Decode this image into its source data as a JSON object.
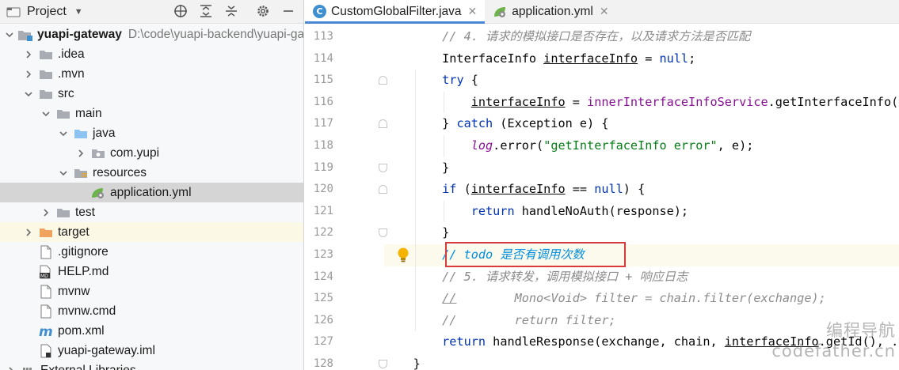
{
  "project_panel": {
    "title": "Project",
    "tree": [
      {
        "label": "yuapi-gateway",
        "path": "D:\\code\\yuapi-backend\\yuapi-gateway",
        "depth": 0,
        "expanded": true,
        "icon": "module-folder-icon",
        "bold": true
      },
      {
        "label": ".idea",
        "depth": 1,
        "expanded": false,
        "icon": "folder-icon"
      },
      {
        "label": ".mvn",
        "depth": 1,
        "expanded": false,
        "icon": "folder-icon"
      },
      {
        "label": "src",
        "depth": 1,
        "expanded": true,
        "icon": "folder-icon"
      },
      {
        "label": "main",
        "depth": 2,
        "expanded": true,
        "icon": "folder-icon"
      },
      {
        "label": "java",
        "depth": 3,
        "expanded": true,
        "icon": "source-folder-icon"
      },
      {
        "label": "com.yupi",
        "depth": 4,
        "expanded": false,
        "icon": "package-icon"
      },
      {
        "label": "resources",
        "depth": 3,
        "expanded": true,
        "icon": "resources-folder-icon"
      },
      {
        "label": "application.yml",
        "depth": 4,
        "icon": "yaml-spring-icon",
        "selected": true
      },
      {
        "label": "test",
        "depth": 2,
        "expanded": false,
        "icon": "folder-icon"
      },
      {
        "label": "target",
        "depth": 1,
        "expanded": false,
        "icon": "excluded-folder-icon"
      },
      {
        "label": ".gitignore",
        "depth": 1,
        "icon": "file-icon"
      },
      {
        "label": "HELP.md",
        "depth": 1,
        "icon": "markdown-icon"
      },
      {
        "label": "mvnw",
        "depth": 1,
        "icon": "file-icon"
      },
      {
        "label": "mvnw.cmd",
        "depth": 1,
        "icon": "file-icon"
      },
      {
        "label": "pom.xml",
        "depth": 1,
        "icon": "maven-icon"
      },
      {
        "label": "yuapi-gateway.iml",
        "depth": 1,
        "icon": "iml-icon"
      },
      {
        "label": "External Libraries",
        "depth": 0,
        "expanded": false,
        "icon": "library-icon"
      }
    ]
  },
  "tabs": [
    {
      "label": "CustomGlobalFilter.java",
      "icon": "java-class-icon",
      "active": true
    },
    {
      "label": "application.yml",
      "icon": "yaml-spring-icon",
      "active": false
    }
  ],
  "editor": {
    "line_numbers": [
      "113",
      "114",
      "115",
      "116",
      "117",
      "118",
      "119",
      "120",
      "121",
      "122",
      "123",
      "124",
      "125",
      "126",
      "127",
      "128"
    ],
    "current_line": "123",
    "todo_marker_line": "123"
  },
  "code_lines": [
    [
      {
        "t": "        "
      },
      {
        "t": "// 4. 请求的模拟接口是否存在，以及请求方法是否匹配",
        "c": "cm"
      }
    ],
    [
      {
        "t": "        InterfaceInfo "
      },
      {
        "t": "interfaceInfo",
        "c": "ul"
      },
      {
        "t": " = "
      },
      {
        "t": "null",
        "c": "kw"
      },
      {
        "t": ";"
      }
    ],
    [
      {
        "t": "        "
      },
      {
        "t": "try",
        "c": "kw"
      },
      {
        "t": " {"
      }
    ],
    [
      {
        "t": "            "
      },
      {
        "t": "interfaceInfo",
        "c": "ul"
      },
      {
        "t": " = "
      },
      {
        "t": "innerInterfaceInfoService",
        "c": "fld"
      },
      {
        "t": ".getInterfaceInfo(path, method);"
      }
    ],
    [
      {
        "t": "        } "
      },
      {
        "t": "catch",
        "c": "kw"
      },
      {
        "t": " (Exception e) {"
      }
    ],
    [
      {
        "t": "            "
      },
      {
        "t": "log",
        "c": "log"
      },
      {
        "t": ".error("
      },
      {
        "t": "\"getInterfaceInfo error\"",
        "c": "str"
      },
      {
        "t": ", e);"
      }
    ],
    [
      {
        "t": "        }"
      }
    ],
    [
      {
        "t": "        "
      },
      {
        "t": "if",
        "c": "kw"
      },
      {
        "t": " ("
      },
      {
        "t": "interfaceInfo",
        "c": "ul"
      },
      {
        "t": " == "
      },
      {
        "t": "null",
        "c": "kw"
      },
      {
        "t": ") {"
      }
    ],
    [
      {
        "t": "            "
      },
      {
        "t": "return",
        "c": "kw"
      },
      {
        "t": " handleNoAuth(response);"
      }
    ],
    [
      {
        "t": "        }"
      }
    ],
    [
      {
        "t": "        "
      },
      {
        "t": "// todo 是否有调用次数",
        "c": "todo"
      }
    ],
    [
      {
        "t": "        "
      },
      {
        "t": "// 5. 请求转发，调用模拟接口 + 响应日志",
        "c": "cm"
      }
    ],
    [
      {
        "t": "        "
      },
      {
        "t": "//",
        "c": "cm ul"
      },
      {
        "t": "        Mono<Void> filter = chain.filter(exchange);",
        "c": "cm"
      }
    ],
    [
      {
        "t": "        "
      },
      {
        "t": "//        return filter;",
        "c": "cm"
      }
    ],
    [
      {
        "t": "        "
      },
      {
        "t": "return",
        "c": "kw"
      },
      {
        "t": " handleResponse(exchange, chain, "
      },
      {
        "t": "interfaceInfo",
        "c": "ul"
      },
      {
        "t": ".getId(), ..."
      }
    ],
    [
      {
        "t": "    }"
      }
    ]
  ],
  "watermark": {
    "line1": "编程导航",
    "line2": "codefather.cn"
  }
}
